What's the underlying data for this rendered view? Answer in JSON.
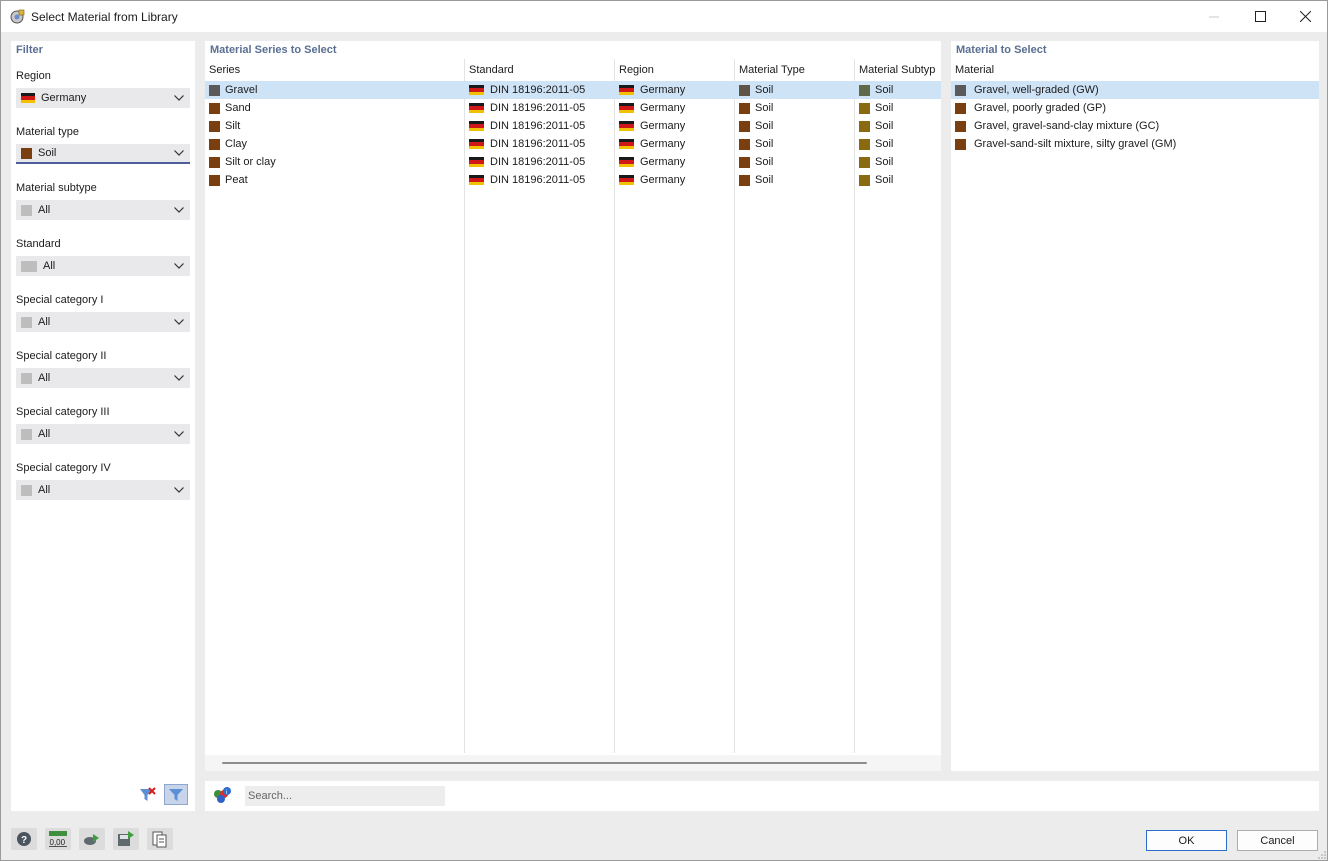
{
  "window": {
    "title": "Select Material from Library"
  },
  "filter": {
    "title": "Filter",
    "fields": [
      {
        "label": "Region",
        "value": "Germany",
        "icon": "germany-flag-icon"
      },
      {
        "label": "Material type",
        "value": "Soil",
        "color": "#7a3f10"
      },
      {
        "label": "Material subtype",
        "value": "All",
        "color": "#bdbdbd"
      },
      {
        "label": "Standard",
        "value": "All",
        "color": "#bdbdbd"
      },
      {
        "label": "Special category I",
        "value": "All",
        "color": "#bdbdbd"
      },
      {
        "label": "Special category II",
        "value": "All",
        "color": "#bdbdbd"
      },
      {
        "label": "Special category III",
        "value": "All",
        "color": "#bdbdbd"
      },
      {
        "label": "Special category IV",
        "value": "All",
        "color": "#bdbdbd"
      }
    ]
  },
  "series_panel": {
    "title": "Material Series to Select",
    "columns": [
      "Series",
      "Standard",
      "Region",
      "Material Type",
      "Material Subtyp"
    ],
    "rows": [
      {
        "series": "Gravel",
        "series_color": "#5a5a5a",
        "standard": "DIN 18196:2011-05",
        "region": "Germany",
        "type": "Soil",
        "type_color": "#5e5448",
        "subtype": "Soil",
        "subtype_color": "#5f6a4a"
      },
      {
        "series": "Sand",
        "series_color": "#7a3f10",
        "standard": "DIN 18196:2011-05",
        "region": "Germany",
        "type": "Soil",
        "type_color": "#7a3f10",
        "subtype": "Soil",
        "subtype_color": "#8a6a10"
      },
      {
        "series": "Silt",
        "series_color": "#7a3f10",
        "standard": "DIN 18196:2011-05",
        "region": "Germany",
        "type": "Soil",
        "type_color": "#7a3f10",
        "subtype": "Soil",
        "subtype_color": "#8a6a10"
      },
      {
        "series": "Clay",
        "series_color": "#7a3f10",
        "standard": "DIN 18196:2011-05",
        "region": "Germany",
        "type": "Soil",
        "type_color": "#7a3f10",
        "subtype": "Soil",
        "subtype_color": "#8a6a10"
      },
      {
        "series": "Silt or clay",
        "series_color": "#7a3f10",
        "standard": "DIN 18196:2011-05",
        "region": "Germany",
        "type": "Soil",
        "type_color": "#7a3f10",
        "subtype": "Soil",
        "subtype_color": "#8a6a10"
      },
      {
        "series": "Peat",
        "series_color": "#7a3f10",
        "standard": "DIN 18196:2011-05",
        "region": "Germany",
        "type": "Soil",
        "type_color": "#7a3f10",
        "subtype": "Soil",
        "subtype_color": "#8a6a10"
      }
    ]
  },
  "material_panel": {
    "title": "Material to Select",
    "column": "Material",
    "rows": [
      {
        "name": "Gravel, well-graded (GW)",
        "color": "#5a5a5a"
      },
      {
        "name": "Gravel, poorly graded (GP)",
        "color": "#7a3f10"
      },
      {
        "name": "Gravel, gravel-sand-clay mixture (GC)",
        "color": "#7a3f10"
      },
      {
        "name": "Gravel-sand-silt mixture, silty gravel (GM)",
        "color": "#7a3f10"
      }
    ]
  },
  "search": {
    "placeholder": "Search..."
  },
  "buttons": {
    "ok": "OK",
    "cancel": "Cancel"
  },
  "accent": "#2b6ecb",
  "selection_color": "#cfe3f7"
}
